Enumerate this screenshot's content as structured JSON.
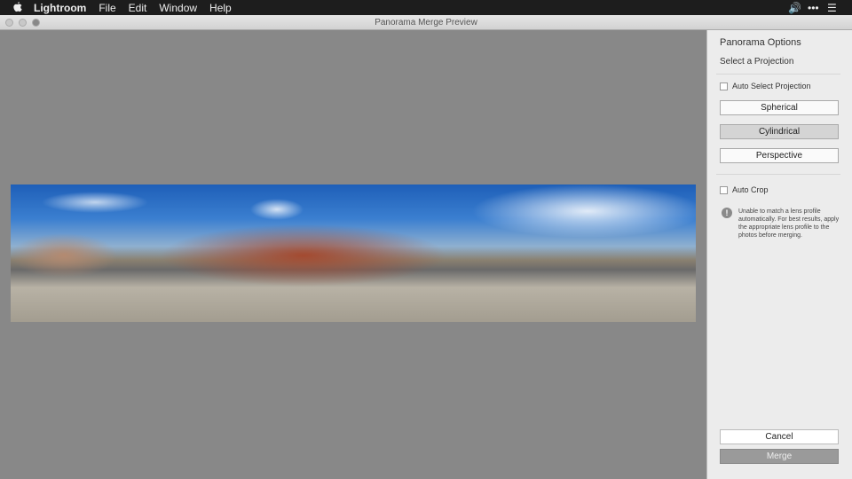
{
  "menubar": {
    "app": "Lightroom",
    "items": [
      "File",
      "Edit",
      "Window",
      "Help"
    ]
  },
  "window": {
    "title": "Panorama Merge Preview"
  },
  "panel": {
    "title": "Panorama Options",
    "subtitle": "Select a Projection",
    "auto_select_label": "Auto Select Projection",
    "auto_select_checked": false,
    "projections": [
      "Spherical",
      "Cylindrical",
      "Perspective"
    ],
    "selected_projection": "Cylindrical",
    "auto_crop_label": "Auto Crop",
    "auto_crop_checked": false,
    "warning": "Unable to match a lens profile automatically. For best results, apply the appropriate lens profile to the photos before merging.",
    "cancel_label": "Cancel",
    "merge_label": "Merge"
  }
}
